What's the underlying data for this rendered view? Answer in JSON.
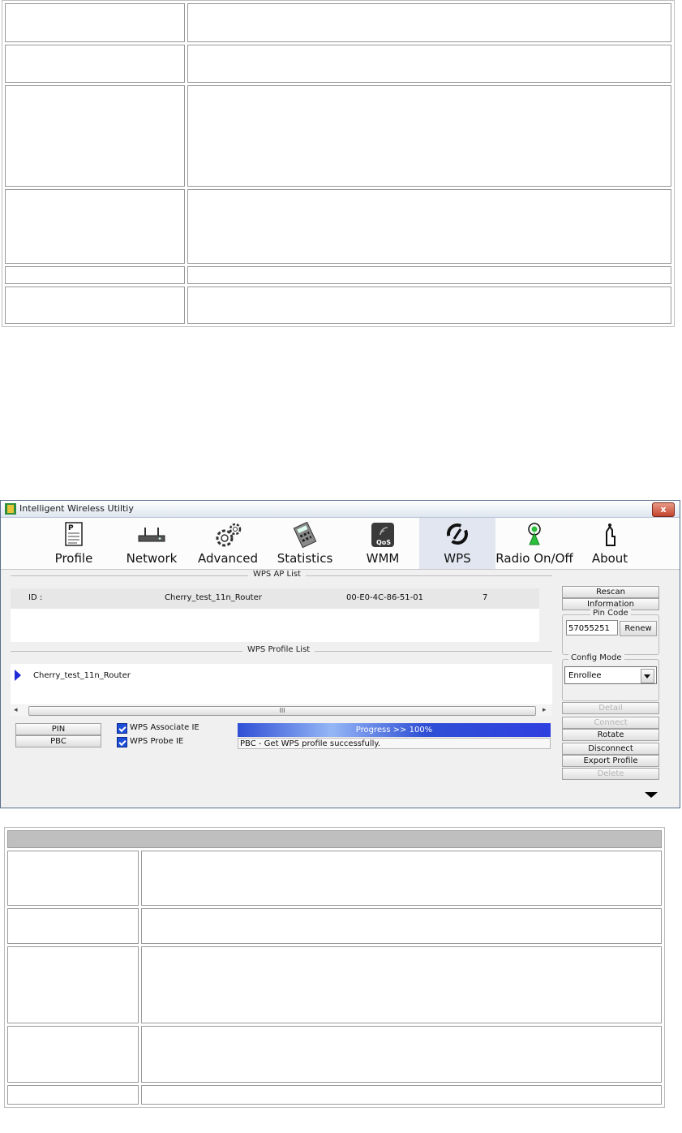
{
  "window": {
    "title": "Intelligent Wireless Utiltiy",
    "close_label": "x"
  },
  "toolbar": {
    "items": [
      {
        "label": "Profile",
        "icon": "profile-icon"
      },
      {
        "label": "Network",
        "icon": "router-icon"
      },
      {
        "label": "Advanced",
        "icon": "gears-icon"
      },
      {
        "label": "Statistics",
        "icon": "calculator-icon"
      },
      {
        "label": "WMM",
        "icon": "qos-icon"
      },
      {
        "label": "WPS",
        "icon": "wps-icon",
        "active": true
      },
      {
        "label": "Radio On/Off",
        "icon": "radio-icon"
      },
      {
        "label": "About",
        "icon": "about-icon"
      }
    ]
  },
  "wps": {
    "ap_list_title": "WPS AP List",
    "ap_rows": [
      {
        "id_label": "ID :",
        "ssid": "Cherry_test_11n_Router",
        "mac": "00-E0-4C-86-51-01",
        "channel": "7"
      }
    ],
    "profile_list_title": "WPS Profile List",
    "profiles": [
      "Cherry_test_11n_Router"
    ],
    "scroll_thumb_label": "III",
    "pin_button": "PIN",
    "pbc_button": "PBC",
    "associate_ie_label": "WPS Associate IE",
    "probe_ie_label": "WPS Probe IE",
    "progress_text": "Progress >> 100%",
    "progress": 1.0,
    "status_text": "PBC - Get WPS profile successfully."
  },
  "sidebar": {
    "rescan": "Rescan",
    "information": "Information",
    "pin_code_legend": "Pin Code",
    "pin_code_value": "57055251",
    "renew": "Renew",
    "config_mode_legend": "Config Mode",
    "config_mode_value": "Enrollee",
    "detail": "Detail",
    "connect": "Connect",
    "rotate": "Rotate",
    "disconnect": "Disconnect",
    "export_profile": "Export Profile",
    "delete": "Delete"
  }
}
